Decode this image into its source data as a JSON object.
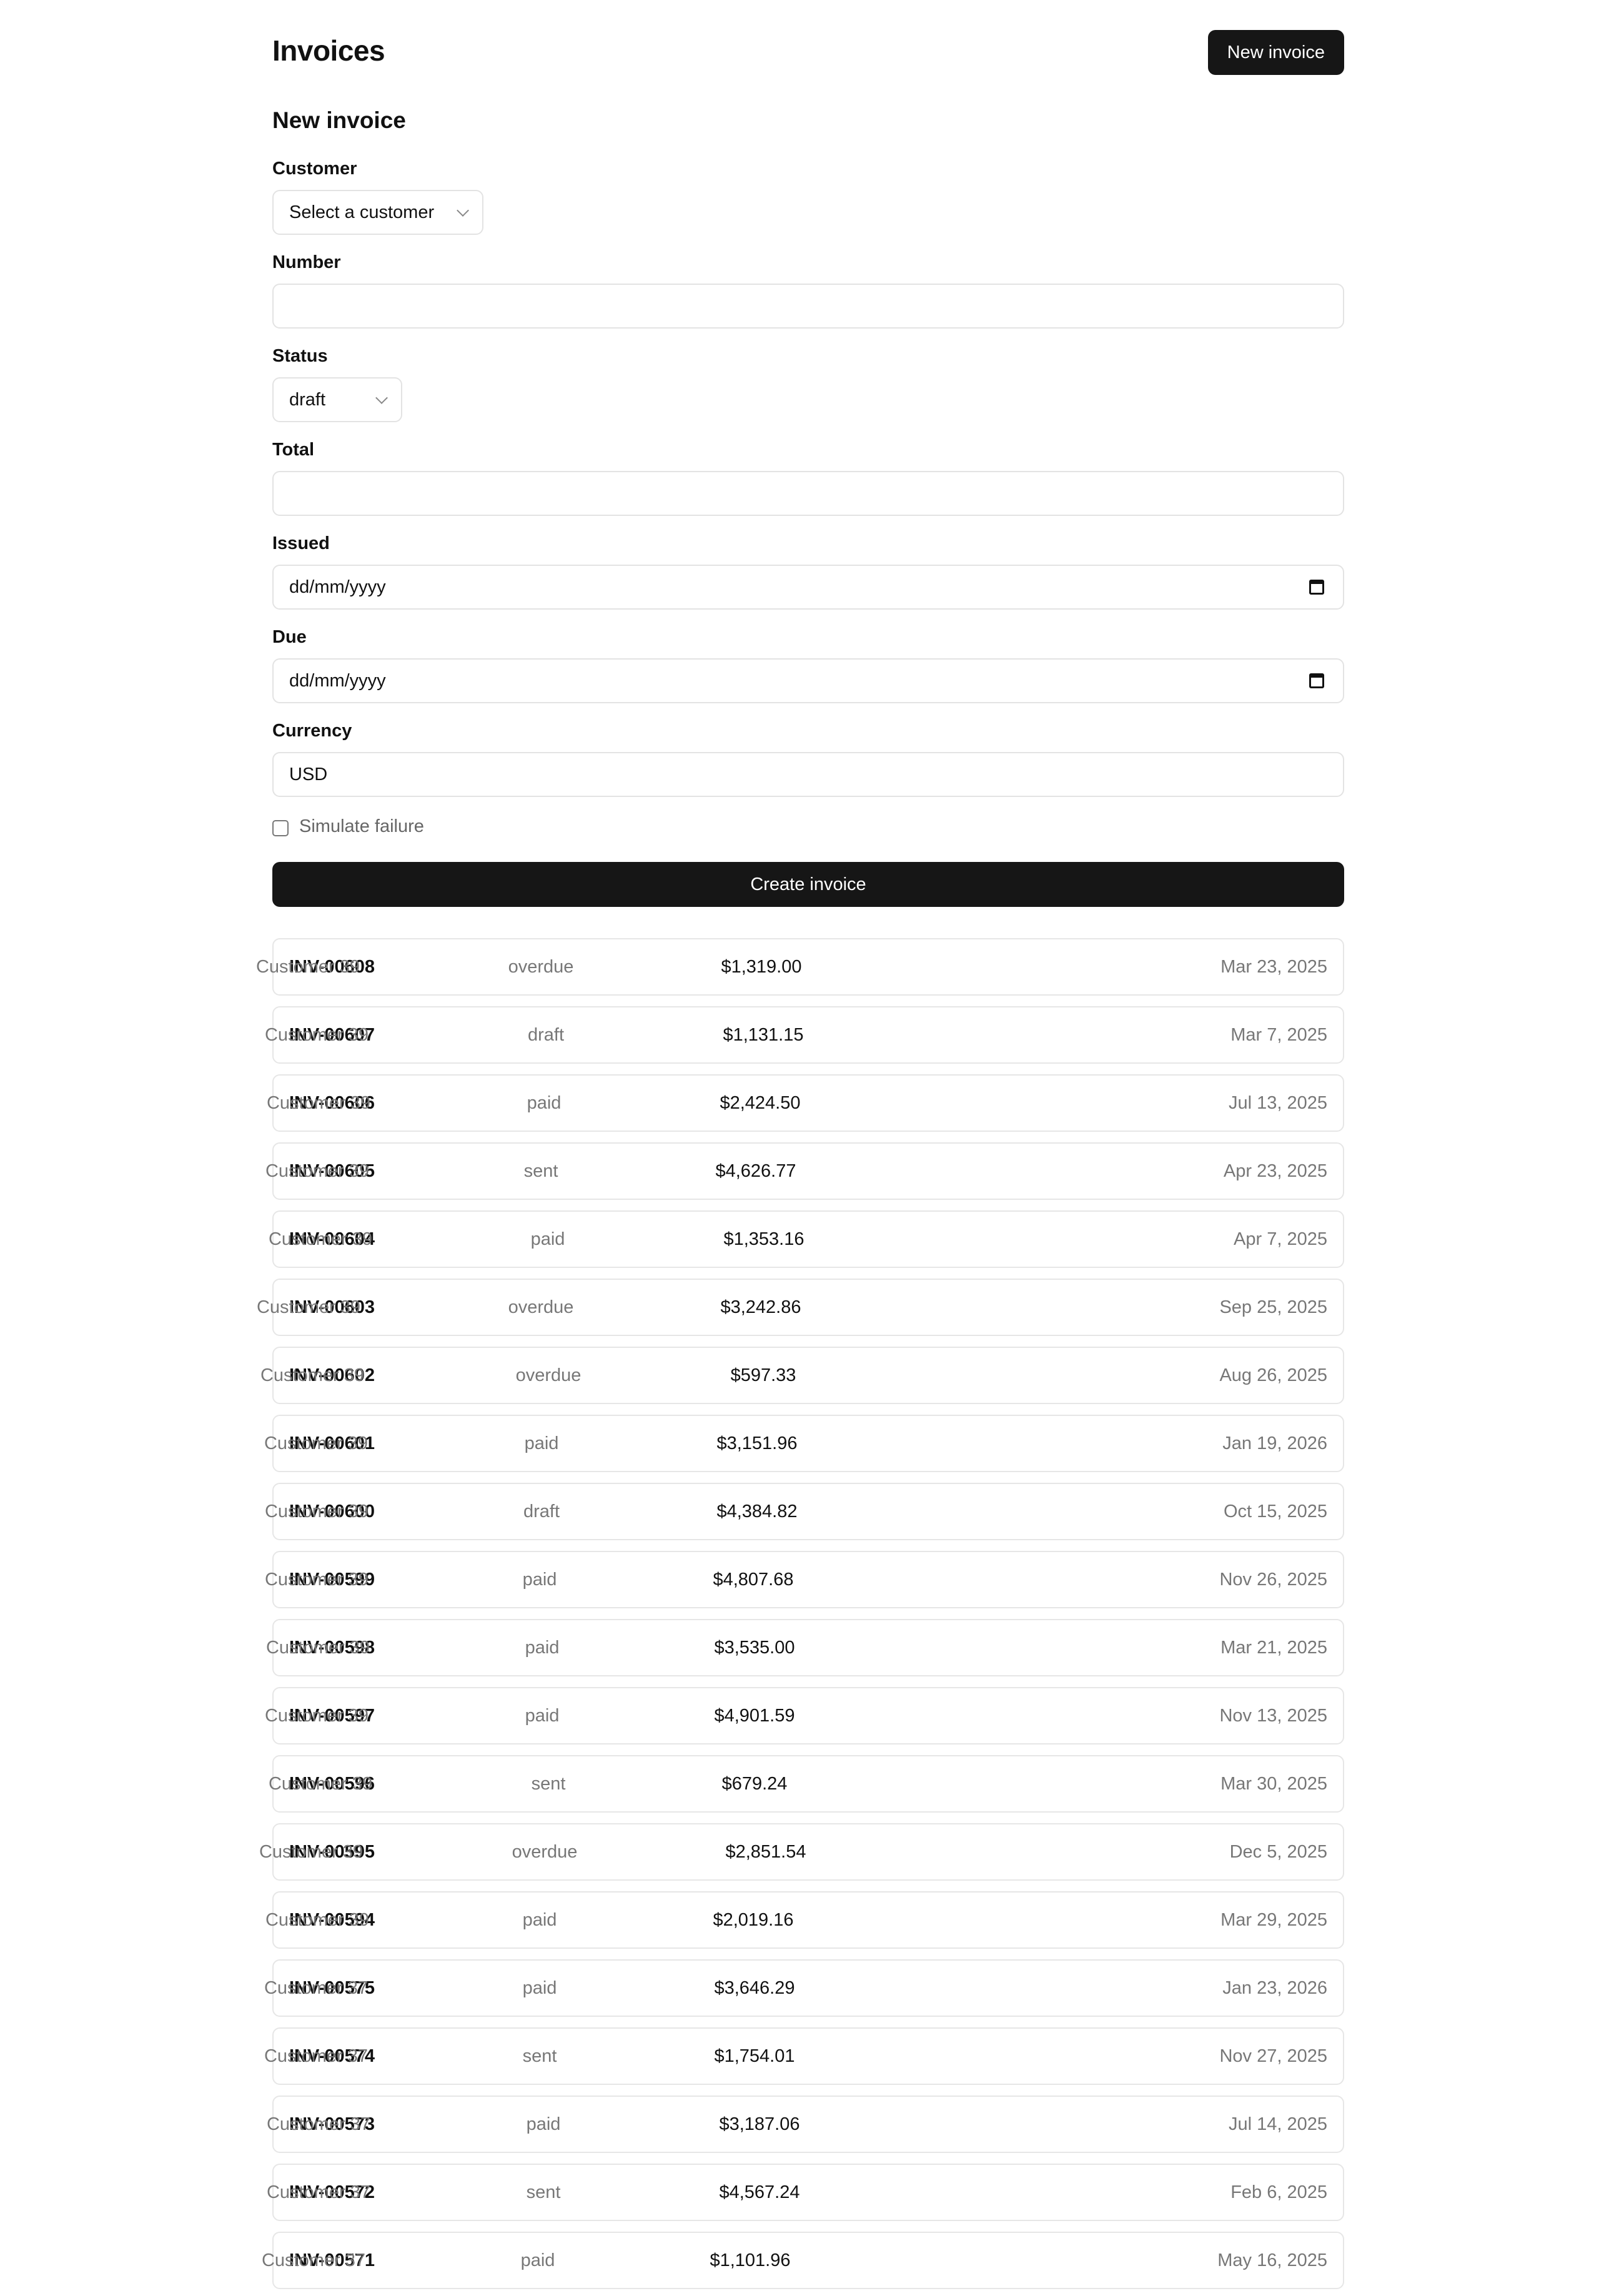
{
  "header": {
    "title": "Invoices",
    "new_invoice_label": "New invoice"
  },
  "form": {
    "title": "New invoice",
    "customer": {
      "label": "Customer",
      "value": "Select a customer"
    },
    "number": {
      "label": "Number",
      "value": ""
    },
    "status": {
      "label": "Status",
      "value": "draft"
    },
    "total": {
      "label": "Total",
      "value": ""
    },
    "issued": {
      "label": "Issued",
      "value": "dd/mm/yyyy"
    },
    "due": {
      "label": "Due",
      "value": "dd/mm/yyyy"
    },
    "currency": {
      "label": "Currency",
      "value": "USD"
    },
    "simulate_failure": {
      "label": "Simulate failure",
      "checked": false
    },
    "submit_label": "Create invoice"
  },
  "invoices": [
    {
      "number": "INV-00608",
      "customer": "Customer 39",
      "status": "overdue",
      "total": "$1,319.00",
      "date": "Mar 23, 2025"
    },
    {
      "number": "INV-00607",
      "customer": "Customer 39",
      "status": "draft",
      "total": "$1,131.15",
      "date": "Mar 7, 2025"
    },
    {
      "number": "INV-00606",
      "customer": "Customer 39",
      "status": "paid",
      "total": "$2,424.50",
      "date": "Jul 13, 2025"
    },
    {
      "number": "INV-00605",
      "customer": "Customer 39",
      "status": "sent",
      "total": "$4,626.77",
      "date": "Apr 23, 2025"
    },
    {
      "number": "INV-00604",
      "customer": "Customer 39",
      "status": "paid",
      "total": "$1,353.16",
      "date": "Apr 7, 2025"
    },
    {
      "number": "INV-00603",
      "customer": "Customer 39",
      "status": "overdue",
      "total": "$3,242.86",
      "date": "Sep 25, 2025"
    },
    {
      "number": "INV-00602",
      "customer": "Customer 39",
      "status": "overdue",
      "total": "$597.33",
      "date": "Aug 26, 2025"
    },
    {
      "number": "INV-00601",
      "customer": "Customer 39",
      "status": "paid",
      "total": "$3,151.96",
      "date": "Jan 19, 2026"
    },
    {
      "number": "INV-00600",
      "customer": "Customer 39",
      "status": "draft",
      "total": "$4,384.82",
      "date": "Oct 15, 2025"
    },
    {
      "number": "INV-00599",
      "customer": "Customer 39",
      "status": "paid",
      "total": "$4,807.68",
      "date": "Nov 26, 2025"
    },
    {
      "number": "INV-00598",
      "customer": "Customer 39",
      "status": "paid",
      "total": "$3,535.00",
      "date": "Mar 21, 2025"
    },
    {
      "number": "INV-00597",
      "customer": "Customer 39",
      "status": "paid",
      "total": "$4,901.59",
      "date": "Nov 13, 2025"
    },
    {
      "number": "INV-00596",
      "customer": "Customer 39",
      "status": "sent",
      "total": "$679.24",
      "date": "Mar 30, 2025"
    },
    {
      "number": "INV-00595",
      "customer": "Customer 39",
      "status": "overdue",
      "total": "$2,851.54",
      "date": "Dec 5, 2025"
    },
    {
      "number": "INV-00594",
      "customer": "Customer 39",
      "status": "paid",
      "total": "$2,019.16",
      "date": "Mar 29, 2025"
    },
    {
      "number": "INV-00575",
      "customer": "Customer 37",
      "status": "paid",
      "total": "$3,646.29",
      "date": "Jan 23, 2026"
    },
    {
      "number": "INV-00574",
      "customer": "Customer 37",
      "status": "sent",
      "total": "$1,754.01",
      "date": "Nov 27, 2025"
    },
    {
      "number": "INV-00573",
      "customer": "Customer 37",
      "status": "paid",
      "total": "$3,187.06",
      "date": "Jul 14, 2025"
    },
    {
      "number": "INV-00572",
      "customer": "Customer 37",
      "status": "sent",
      "total": "$4,567.24",
      "date": "Feb 6, 2025"
    },
    {
      "number": "INV-00571",
      "customer": "Customer 37",
      "status": "paid",
      "total": "$1,101.96",
      "date": "May 16, 2025"
    }
  ]
}
